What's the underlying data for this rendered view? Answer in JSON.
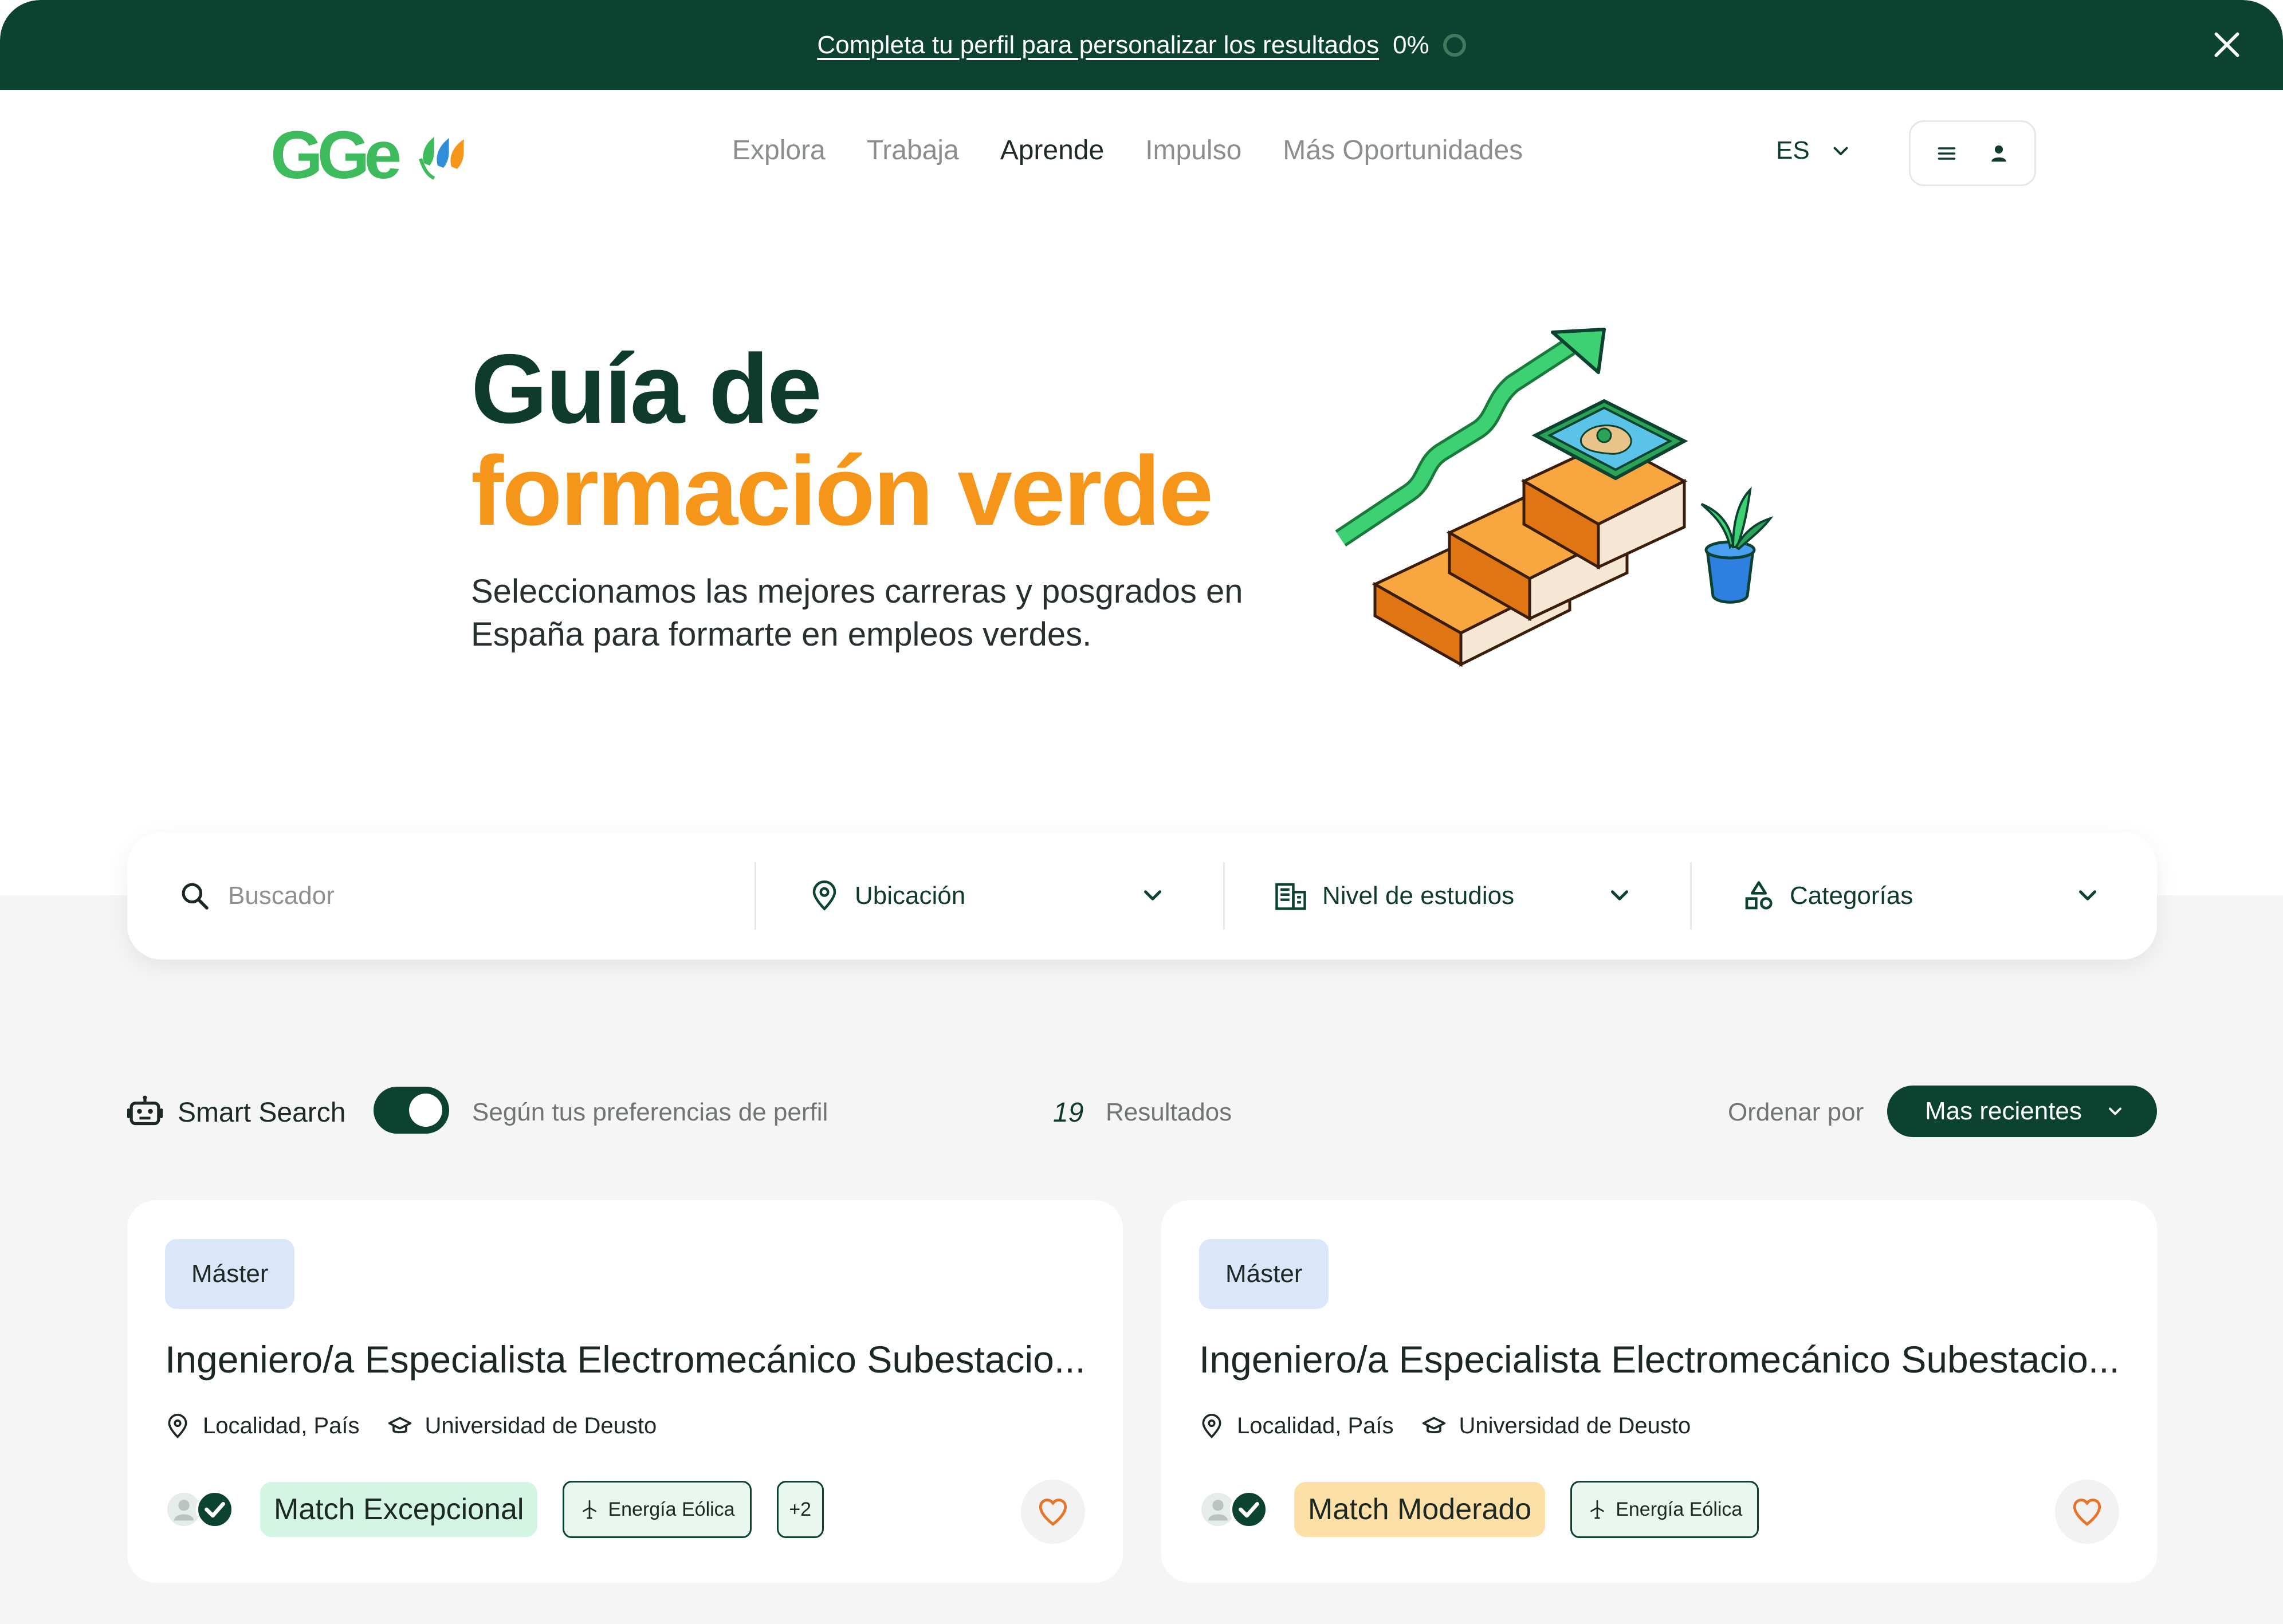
{
  "banner": {
    "link_text": "Completa tu perfil para personalizar los resultados",
    "percent": "0%"
  },
  "header": {
    "logo_text": "GGe",
    "nav": [
      {
        "label": "Explora"
      },
      {
        "label": "Trabaja"
      },
      {
        "label": "Aprende"
      },
      {
        "label": "Impulso"
      },
      {
        "label": "Más Oportunidades"
      }
    ],
    "language": "ES"
  },
  "hero": {
    "title_line1": "Guía de",
    "title_line2": "formación verde",
    "subtitle": "Seleccionamos las mejores carreras y posgrados en España para formarte en empleos verdes."
  },
  "search": {
    "placeholder": "Buscador",
    "location_label": "Ubicación",
    "level_label": "Nivel de estudios",
    "categories_label": "Categorías"
  },
  "smart_search": {
    "label": "Smart Search",
    "enabled": true,
    "preference_text": "Según tus preferencias de perfil",
    "result_count": "19",
    "results_label": "Resultados",
    "sort_label": "Ordenar por",
    "sort_value": "Mas recientes"
  },
  "cards": [
    {
      "type": "Máster",
      "title": "Ingeniero/a Especialista Electromecánico Subestacio...",
      "location": "Localidad, País",
      "institution": "Universidad de Deusto",
      "match": "Match Excepcional",
      "category": "Energía Eólica",
      "extra": "+2"
    },
    {
      "type": "Máster",
      "title": "Ingeniero/a Especialista Electromecánico Subestacio...",
      "location": "Localidad, País",
      "institution": "Universidad de Deusto",
      "match": "Match Moderado",
      "category": "Energía Eólica"
    }
  ],
  "colors": {
    "primary_dark": "#0b4230",
    "accent_orange": "#f5961a",
    "logo_green": "#3dbb5d",
    "match_exceptional": "#d4f5e3",
    "match_moderate": "#fde0a8",
    "type_tag": "#dbe6f8"
  },
  "icons": [
    "close-icon",
    "menu-icon",
    "user-icon",
    "chevron-down-icon",
    "search-icon",
    "location-pin-icon",
    "building-icon",
    "shapes-icon",
    "robot-icon",
    "graduation-cap-icon",
    "wind-turbine-icon",
    "heart-icon",
    "check-icon"
  ]
}
